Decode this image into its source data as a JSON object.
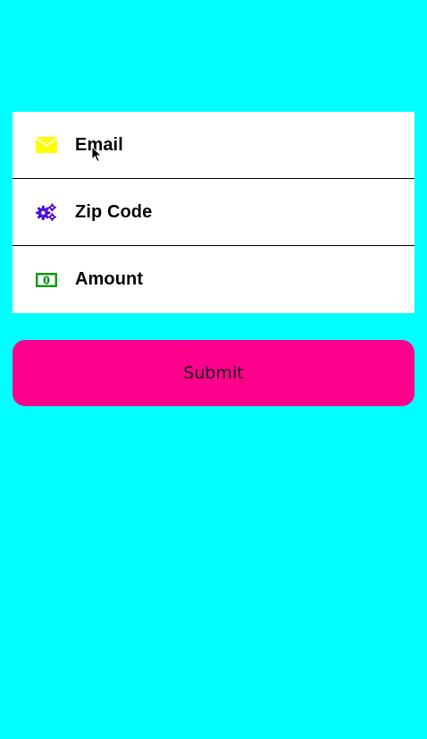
{
  "form": {
    "fields": [
      {
        "label": "Email",
        "icon": "envelope-icon",
        "icon_color": "#FFFF00"
      },
      {
        "label": "Zip Code",
        "icon": "gears-icon",
        "icon_color": "#4B0EE0"
      },
      {
        "label": "Amount",
        "icon": "money-bill-icon",
        "icon_color": "#0A9E1A"
      }
    ]
  },
  "submit": {
    "label": "Submit",
    "color": "#FF008C"
  },
  "colors": {
    "background": "#00FFFF",
    "card": "#FFFFFF",
    "divider": "#000000"
  }
}
